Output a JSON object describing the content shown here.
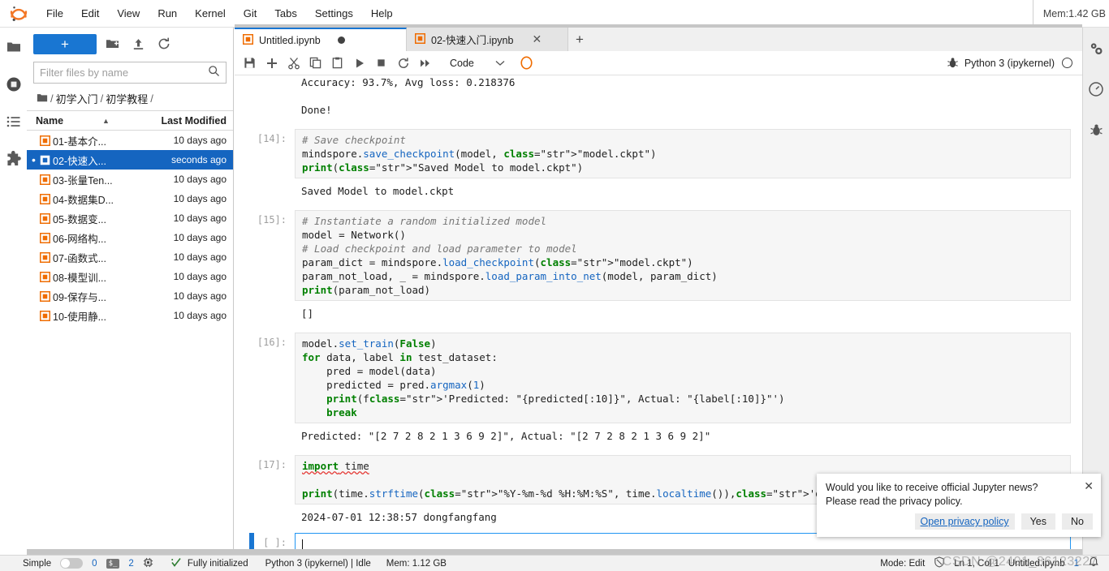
{
  "app": {
    "logo_name": "jupyter-logo",
    "memory_top": "Mem:1.42 GB"
  },
  "menubar": {
    "items": [
      {
        "label": "File"
      },
      {
        "label": "Edit"
      },
      {
        "label": "View"
      },
      {
        "label": "Run"
      },
      {
        "label": "Kernel"
      },
      {
        "label": "Git"
      },
      {
        "label": "Tabs"
      },
      {
        "label": "Settings"
      },
      {
        "label": "Help"
      }
    ]
  },
  "left_activity_bar": {
    "items": [
      {
        "name": "file-browser-icon",
        "title": "File Browser"
      },
      {
        "name": "running-terminals-icon",
        "title": "Running Terminals and Kernels"
      },
      {
        "name": "commands-list-icon",
        "title": "Commands"
      },
      {
        "name": "extension-manager-icon",
        "title": "Extension Manager"
      }
    ]
  },
  "right_activity_bar": {
    "items": [
      {
        "name": "property-inspector-icon",
        "title": "Property Inspector"
      },
      {
        "name": "dashboard-gauge-icon",
        "title": "Dashboard"
      },
      {
        "name": "debugger-bug-icon",
        "title": "Debugger"
      }
    ]
  },
  "filebrowser": {
    "new_button_label": "+",
    "toolbar_icons": [
      "new-folder-icon",
      "upload-icon",
      "refresh-icon"
    ],
    "filter_placeholder": "Filter files by name",
    "filter_value": "",
    "breadcrumb": [
      "初学入门",
      "初学教程"
    ],
    "columns": {
      "name": "Name",
      "last_modified": "Last Modified"
    },
    "sort_indicator": "▲",
    "files": [
      {
        "name": "01-基本介...",
        "modified": "10 days ago",
        "selected": false,
        "running": false
      },
      {
        "name": "02-快速入...",
        "modified": "seconds ago",
        "selected": true,
        "running": true
      },
      {
        "name": "03-张量Ten...",
        "modified": "10 days ago",
        "selected": false,
        "running": false
      },
      {
        "name": "04-数据集D...",
        "modified": "10 days ago",
        "selected": false,
        "running": false
      },
      {
        "name": "05-数据变...",
        "modified": "10 days ago",
        "selected": false,
        "running": false
      },
      {
        "name": "06-网络构...",
        "modified": "10 days ago",
        "selected": false,
        "running": false
      },
      {
        "name": "07-函数式...",
        "modified": "10 days ago",
        "selected": false,
        "running": false
      },
      {
        "name": "08-模型训...",
        "modified": "10 days ago",
        "selected": false,
        "running": false
      },
      {
        "name": "09-保存与...",
        "modified": "10 days ago",
        "selected": false,
        "running": false
      },
      {
        "name": "10-使用静...",
        "modified": "10 days ago",
        "selected": false,
        "running": false
      }
    ]
  },
  "tabs": [
    {
      "label": "Untitled.ipynb",
      "active": true,
      "dirty": true
    },
    {
      "label": "02-快速入门.ipynb",
      "active": false,
      "dirty": false
    }
  ],
  "notebook_toolbar": {
    "buttons": [
      {
        "name": "save-button",
        "title": "Save"
      },
      {
        "name": "insert-cell-button",
        "title": "Insert a cell below"
      },
      {
        "name": "cut-cells-button",
        "title": "Cut"
      },
      {
        "name": "copy-cells-button",
        "title": "Copy"
      },
      {
        "name": "paste-cells-button",
        "title": "Paste"
      },
      {
        "name": "run-cell-button",
        "title": "Run"
      },
      {
        "name": "interrupt-kernel-button",
        "title": "Interrupt"
      },
      {
        "name": "restart-kernel-button",
        "title": "Restart"
      },
      {
        "name": "restart-run-all-button",
        "title": "Restart and run all"
      }
    ],
    "cell_type": "Code",
    "git_icon": "git-pull-icon",
    "debugger_icon": "bug-icon",
    "kernel_name": "Python 3 (ipykernel)",
    "kernel_status": "Idle"
  },
  "notebook": {
    "cells": [
      {
        "type": "output-only",
        "prompt": "",
        "output_lines": [
          "Accuracy: 93.7%, Avg loss: 0.218376",
          "",
          "Done!"
        ]
      },
      {
        "type": "code",
        "prompt": "[14]:",
        "source": "# Save checkpoint\nmindspore.save_checkpoint(model, \"model.ckpt\")\nprint(\"Saved Model to model.ckpt\")",
        "output": "Saved Model to model.ckpt"
      },
      {
        "type": "code",
        "prompt": "[15]:",
        "source": "# Instantiate a random initialized model\nmodel = Network()\n# Load checkpoint and load parameter to model\nparam_dict = mindspore.load_checkpoint(\"model.ckpt\")\nparam_not_load, _ = mindspore.load_param_into_net(model, param_dict)\nprint(param_not_load)",
        "output": "[]"
      },
      {
        "type": "code",
        "prompt": "[16]:",
        "source": "model.set_train(False)\nfor data, label in test_dataset:\n    pred = model(data)\n    predicted = pred.argmax(1)\n    print(f'Predicted: \"{predicted[:10]}\", Actual: \"{label[:10]}\"')\n    break",
        "output": "Predicted: \"[2 7 2 8 2 1 3 6 9 2]\", Actual: \"[2 7 2 8 2 1 3 6 9 2]\""
      },
      {
        "type": "code",
        "prompt": "[17]:",
        "source": "import time\n\nprint(time.strftime(\"%Y-%m-%d %H:%M:%S\", time.localtime()),'dongfangfang')",
        "output": "2024-07-01 12:38:57 dongfangfang"
      },
      {
        "type": "active-empty",
        "prompt": "[ ]:",
        "source": ""
      }
    ]
  },
  "notification": {
    "line1": "Would you like to receive official Jupyter news?",
    "line2": "Please read the privacy policy.",
    "link_label": "Open privacy policy",
    "yes_label": "Yes",
    "no_label": "No",
    "close_label": "✕"
  },
  "statusbar": {
    "simple_label": "Simple",
    "simple_on": false,
    "kernels_count": "0",
    "terminal_badge": "$_",
    "terminals_count": "2",
    "cpu_icon": "cpu-icon",
    "git_status": "Fully initialized",
    "kernel_status": "Python 3 (ipykernel) | Idle",
    "memory": "Mem: 1.12 GB",
    "mode": "Mode: Edit",
    "spell_icon": "spellcheck-disabled-icon",
    "position": "Ln 1, Col 1",
    "filename": "Untitled.ipynb",
    "notifications_count": "1",
    "bell_icon": "bell-icon"
  },
  "watermark": {
    "text": "CSDN @2401_86123227"
  },
  "colors": {
    "accent": "#1976d2",
    "selection": "#1565c0",
    "notebook_icon": "#ef6c00",
    "running_green": "#3ddc84"
  }
}
